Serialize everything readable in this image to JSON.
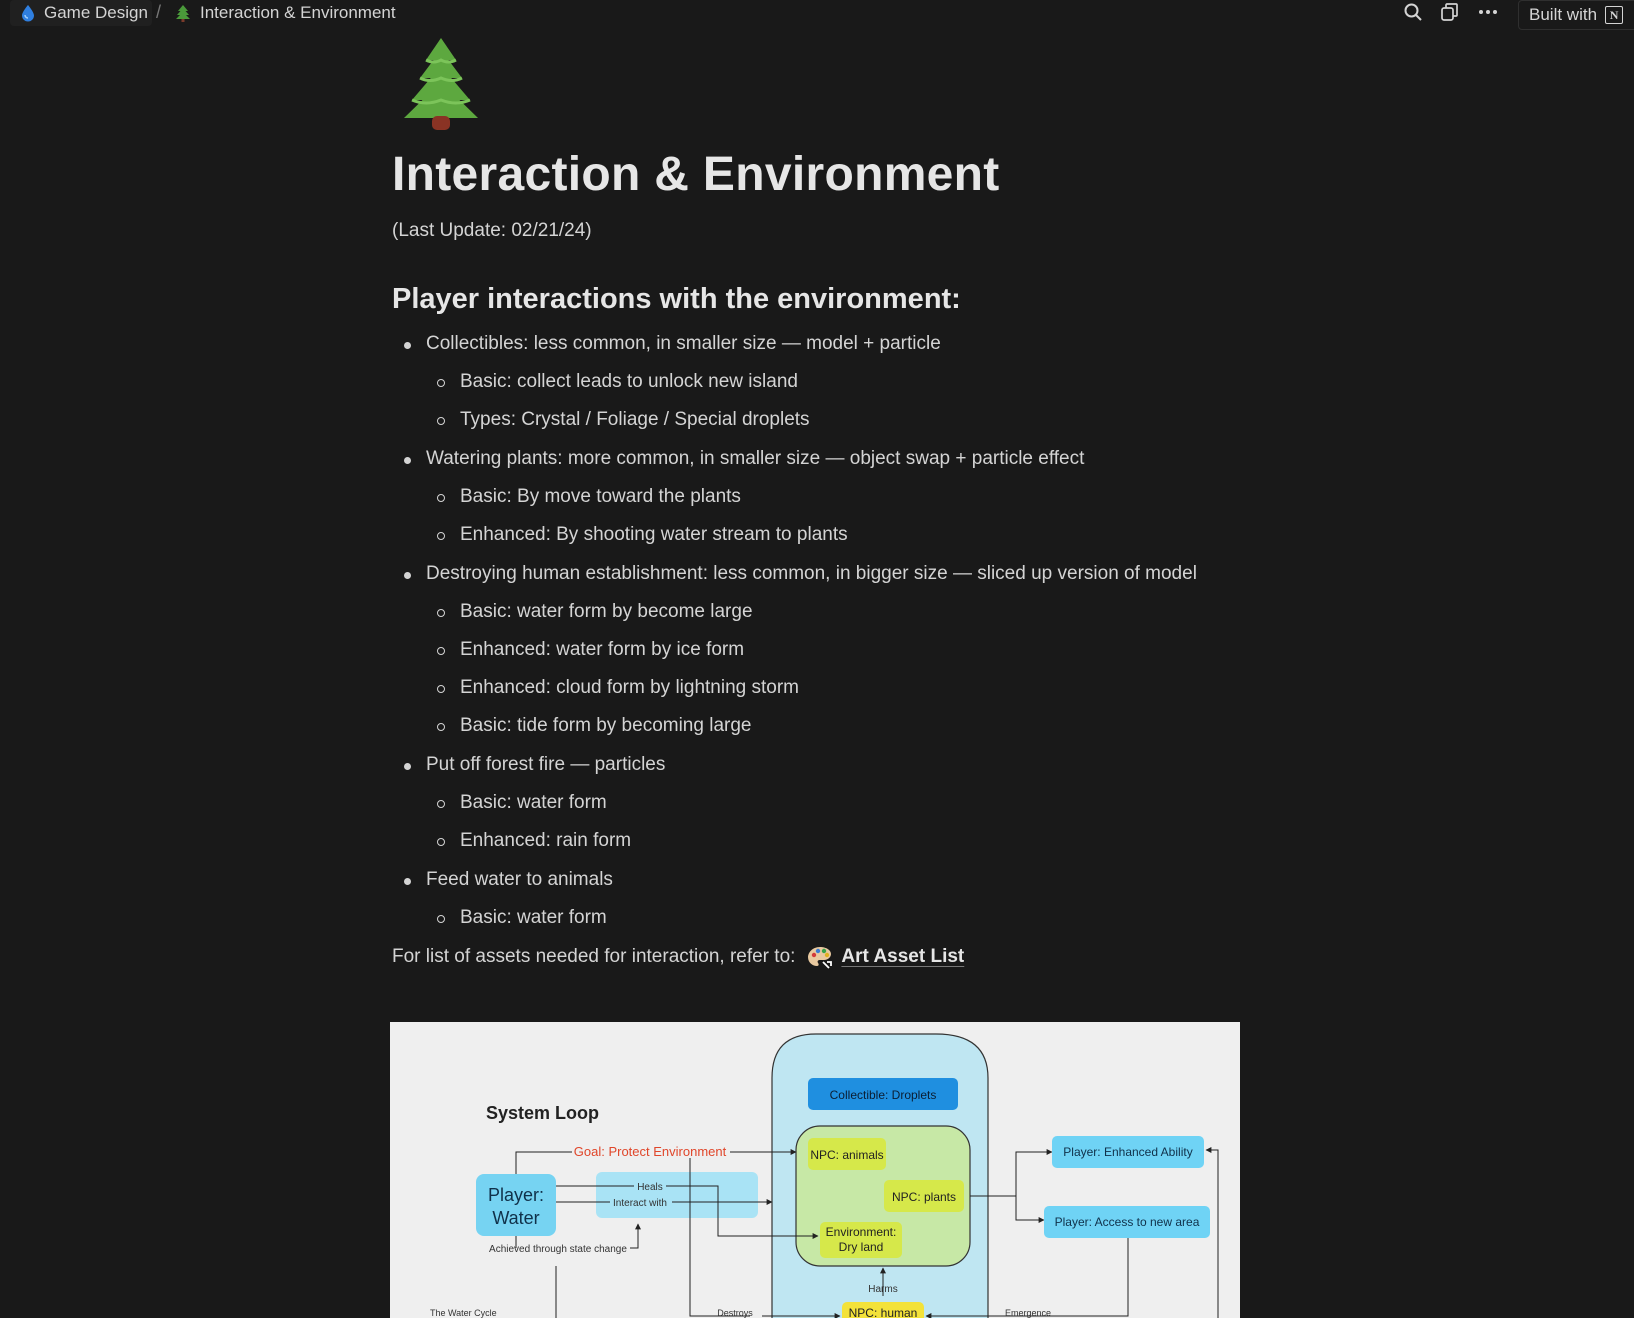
{
  "breadcrumb": {
    "home_label": "Game Design",
    "separator": "/",
    "page_label": "Interaction & Environment"
  },
  "topbar": {
    "built_with_label": "Built with",
    "notion_logo_letter": "N"
  },
  "page": {
    "title": "Interaction & Environment",
    "last_update": "(Last Update: 02/21/24)",
    "heading": "Player interactions with the environment:"
  },
  "bullets": [
    {
      "text": "Collectibles: less common, in smaller size — model + particle",
      "children": [
        "Basic: collect leads to unlock new island",
        "Types: Crystal / Foliage / Special droplets"
      ]
    },
    {
      "text": "Watering plants: more common, in smaller size — object swap + particle effect",
      "children": [
        "Basic: By move toward the plants",
        "Enhanced: By shooting water stream to plants"
      ]
    },
    {
      "text": "Destroying human establishment: less common, in bigger size — sliced up version of model",
      "children": [
        "Basic: water form by become large",
        "Enhanced: water form by ice form",
        "Enhanced: cloud form by lightning storm",
        "Basic: tide form by becoming large"
      ]
    },
    {
      "text": "Put off forest fire — particles",
      "children": [
        "Basic: water form",
        "Enhanced: rain form"
      ]
    },
    {
      "text": "Feed water to animals",
      "children": [
        "Basic: water form"
      ]
    }
  ],
  "refer": {
    "text": "For list of assets needed for interaction, refer to:",
    "link_label": "Art Asset List"
  },
  "diagram": {
    "title": "System Loop",
    "collectible": "Collectible: Droplets",
    "goal": "Goal: Protect Environment",
    "player_line1": "Player:",
    "player_line2": "Water",
    "heals": "Heals",
    "interact_with": "Interact with",
    "achieved": "Achieved through state change",
    "npc_animals": "NPC: animals",
    "npc_plants": "NPC: plants",
    "env_line1": "Environment:",
    "env_line2": "Dry land",
    "harms": "Harms",
    "npc_human": "NPC: human",
    "enhanced_ability": "Player: Enhanced Ability",
    "access_new_area": "Player: Access to new area",
    "water_cycle": "The Water Cycle",
    "destroys": "Destroys",
    "emergence": "Emergence"
  }
}
